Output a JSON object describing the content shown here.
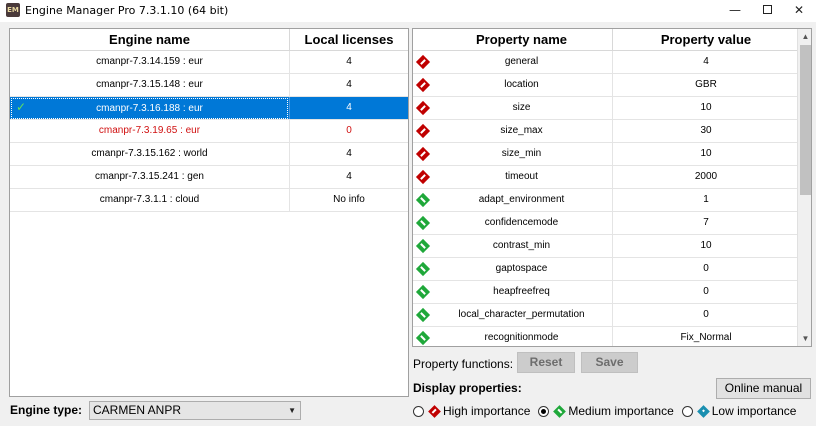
{
  "window": {
    "title": "Engine Manager Pro 7.3.1.10 (64 bit)",
    "app_icon_text": "EM",
    "minimize": "—",
    "close": "✕"
  },
  "engines": {
    "headers": {
      "name": "Engine name",
      "licenses": "Local licenses"
    },
    "rows": [
      {
        "name": "cmanpr-7.3.14.159 : eur",
        "licenses": "4",
        "state": "normal"
      },
      {
        "name": "cmanpr-7.3.15.148 : eur",
        "licenses": "4",
        "state": "normal"
      },
      {
        "name": "cmanpr-7.3.16.188 : eur",
        "licenses": "4",
        "state": "selected",
        "check": "✓"
      },
      {
        "name": "cmanpr-7.3.19.65 : eur",
        "licenses": "0",
        "state": "error"
      },
      {
        "name": "cmanpr-7.3.15.162 : world",
        "licenses": "4",
        "state": "normal"
      },
      {
        "name": "cmanpr-7.3.15.241 : gen",
        "licenses": "4",
        "state": "normal"
      },
      {
        "name": "cmanpr-7.3.1.1 : cloud",
        "licenses": "No info",
        "state": "normal"
      }
    ]
  },
  "engine_type": {
    "label": "Engine type:",
    "selected": "CARMEN ANPR"
  },
  "properties": {
    "headers": {
      "name": "Property name",
      "value": "Property value"
    },
    "rows": [
      {
        "name": "general",
        "value": "4",
        "importance": "high"
      },
      {
        "name": "location",
        "value": "GBR",
        "importance": "high"
      },
      {
        "name": "size",
        "value": "10",
        "importance": "high"
      },
      {
        "name": "size_max",
        "value": "30",
        "importance": "high"
      },
      {
        "name": "size_min",
        "value": "10",
        "importance": "high"
      },
      {
        "name": "timeout",
        "value": "2000",
        "importance": "high"
      },
      {
        "name": "adapt_environment",
        "value": "1",
        "importance": "medium"
      },
      {
        "name": "confidencemode",
        "value": "7",
        "importance": "medium"
      },
      {
        "name": "contrast_min",
        "value": "10",
        "importance": "medium"
      },
      {
        "name": "gaptospace",
        "value": "0",
        "importance": "medium"
      },
      {
        "name": "heapfreefreq",
        "value": "0",
        "importance": "medium"
      },
      {
        "name": "local_character_permutation",
        "value": "0",
        "importance": "medium"
      },
      {
        "name": "recognitionmode",
        "value": "Fix_Normal",
        "importance": "medium"
      }
    ]
  },
  "property_functions": {
    "label": "Property functions:",
    "reset": "Reset",
    "save": "Save"
  },
  "display_properties": {
    "label": "Display properties:",
    "online_manual": "Online manual",
    "options": [
      {
        "label": "High importance",
        "importance": "high",
        "checked": false
      },
      {
        "label": "Medium importance",
        "importance": "medium",
        "checked": true
      },
      {
        "label": "Low importance",
        "importance": "low",
        "checked": false
      }
    ]
  },
  "colors": {
    "selection": "#0078d7",
    "error_text": "#d01010",
    "high": "#c00000",
    "medium": "#1fa83a",
    "low": "#1a8fb0"
  }
}
